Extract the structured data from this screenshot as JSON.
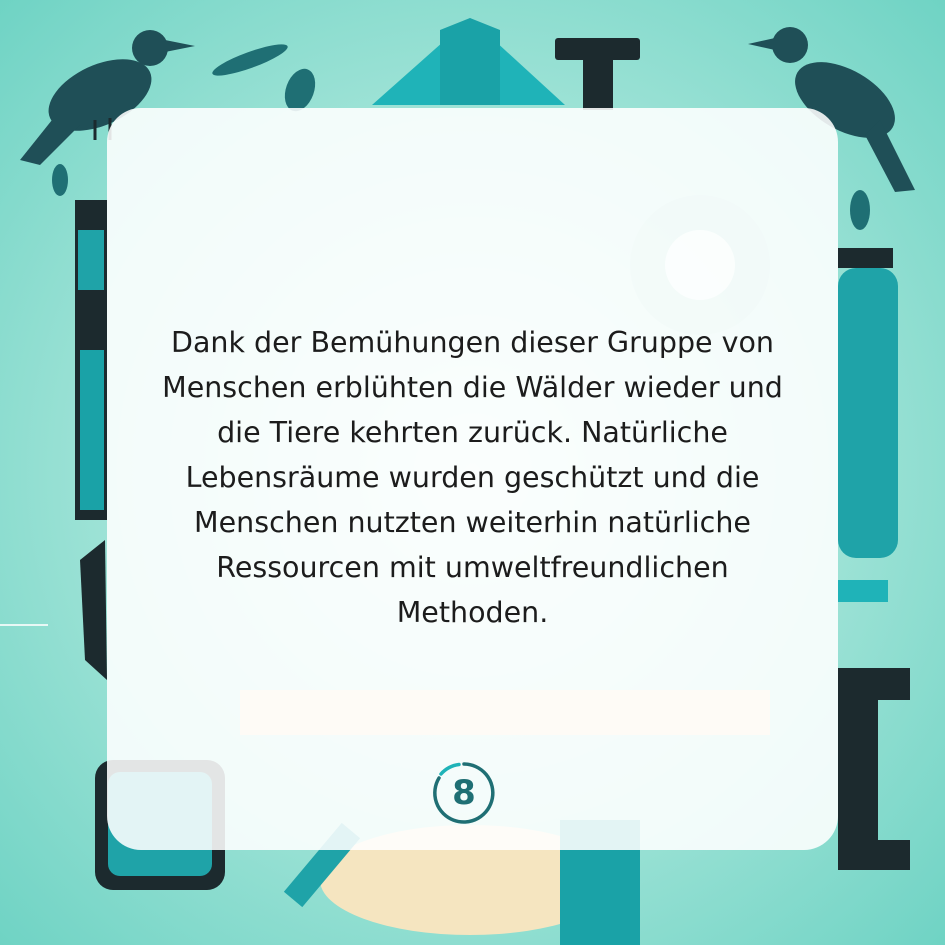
{
  "story": {
    "text": "Dank der Bemühungen dieser Gruppe von Menschen erblühten die Wälder wieder und die Tiere kehrten zurück. Natürliche Lebensräume wurden geschützt und die Menschen nutzten weiterhin natürliche Ressourcen mit umweltfreundlichen Methoden."
  },
  "page": {
    "number": "8"
  },
  "colors": {
    "background": "#a8e6da",
    "teal_accent": "#1f9ea3",
    "dark": "#1c2a2e",
    "badge_ring": "#1f6f74"
  },
  "background_icons": [
    "crow-icon",
    "crow-icon",
    "gear-icon",
    "bottle-icon",
    "wooden-plank",
    "leaf-icon",
    "triangle-roof"
  ]
}
